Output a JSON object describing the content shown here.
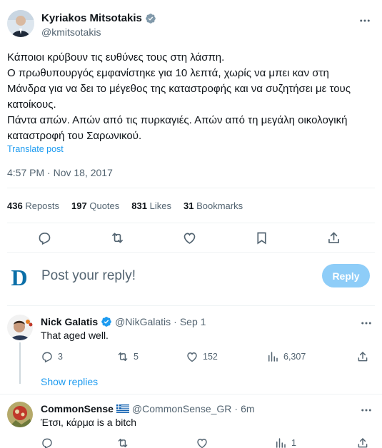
{
  "tweet": {
    "author_name": "Kyriakos Mitsotakis",
    "author_handle": "@kmitsotakis",
    "verified_color": "#829aab",
    "lines": [
      "Κάποιοι κρύβουν τις ευθύνες τους στη λάσπη.",
      "Ο πρωθυπουργός εμφανίστηκε για 10 λεπτά, χωρίς να μπει καν στη",
      "Μάνδρα για να δει το μέγεθος της καταστροφής και να συζητήσει με τους",
      "κατοίκους.",
      "Πάντα απών. Απών από τις πυρκαγιές. Απών από τη μεγάλη οικολογική",
      "καταστροφή του Σαρωνικού."
    ],
    "translate_label": "Translate post",
    "timestamp": "4:57 PM · Nov 18, 2017",
    "stats": {
      "reposts_count": "436",
      "reposts_label": "Reposts",
      "quotes_count": "197",
      "quotes_label": "Quotes",
      "likes_count": "831",
      "likes_label": "Likes",
      "bookmarks_count": "31",
      "bookmarks_label": "Bookmarks"
    },
    "actions": [
      "reply-icon",
      "repost-icon",
      "like-icon",
      "bookmark-icon",
      "share-icon"
    ]
  },
  "composer": {
    "avatar_letter": "D",
    "avatar_color": "#0b6fa8",
    "placeholder": "Post your reply!",
    "reply_button": "Reply",
    "reply_button_color": "#8ecdf8"
  },
  "replies": [
    {
      "name": "Nick Galatis",
      "handle": "@NikGalatis",
      "separator": "·",
      "time": "Sep 1",
      "verified_color": "#1d9bf0",
      "text": "That aged well.",
      "reply_count": "3",
      "repost_count": "5",
      "like_count": "152",
      "view_count": "6,307",
      "show_replies": "Show replies"
    },
    {
      "name": "CommonSense",
      "flag": "Greece",
      "handle": "@CommonSense_GR",
      "separator": "·",
      "time": "6m",
      "text": "Έτσι, κάρμα is a bitch",
      "reply_count": "",
      "repost_count": "",
      "like_count": "",
      "view_count": "1"
    }
  ],
  "colors": {
    "text": "#0f1419",
    "secondary": "#536471",
    "link": "#1d9bf0",
    "divider": "#eff3f4"
  }
}
